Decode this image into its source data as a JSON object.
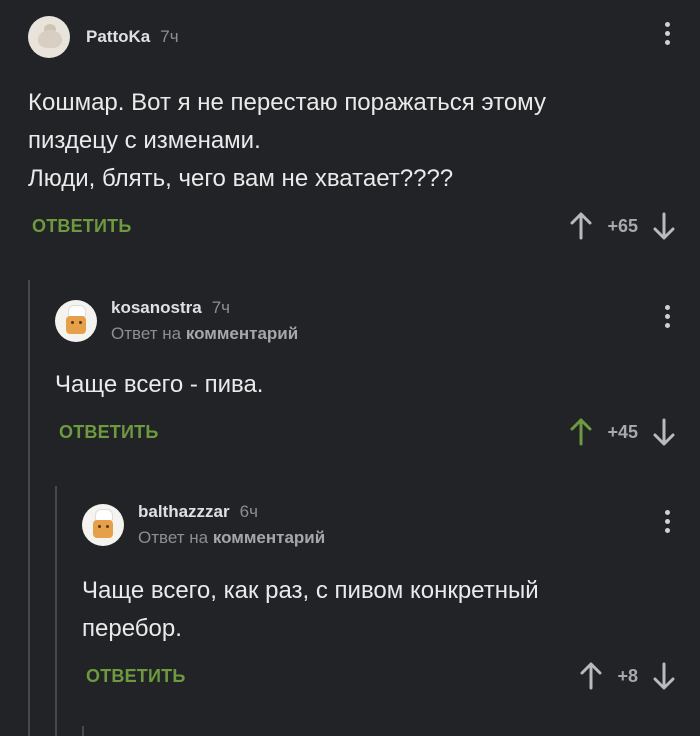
{
  "comments": [
    {
      "username": "PattoKa",
      "time": "7ч",
      "lines": [
        "Кошмар. Вот я не перестаю поражаться этому",
        "пиздецу с изменами.",
        "Люди, блять, чего вам не хватает????"
      ],
      "reply_label": "ОТВЕТИТЬ",
      "score": "+65",
      "upvoted": false
    },
    {
      "username": "kosanostra",
      "time": "7ч",
      "reply_prefix": "Ответ на",
      "reply_target": "комментарий",
      "lines": [
        "Чаще всего - пива."
      ],
      "reply_label": "ОТВЕТИТЬ",
      "score": "+45",
      "upvoted": true
    },
    {
      "username": "balthazzzar",
      "time": "6ч",
      "reply_prefix": "Ответ на",
      "reply_target": "комментарий",
      "lines": [
        "Чаще всего, как раз, с пивом конкретный",
        "перебор."
      ],
      "reply_label": "ОТВЕТИТЬ",
      "score": "+8",
      "upvoted": false
    }
  ],
  "colors": {
    "background": "#222326",
    "accent_green": "#6e9a3f",
    "muted": "#8d8e91"
  }
}
